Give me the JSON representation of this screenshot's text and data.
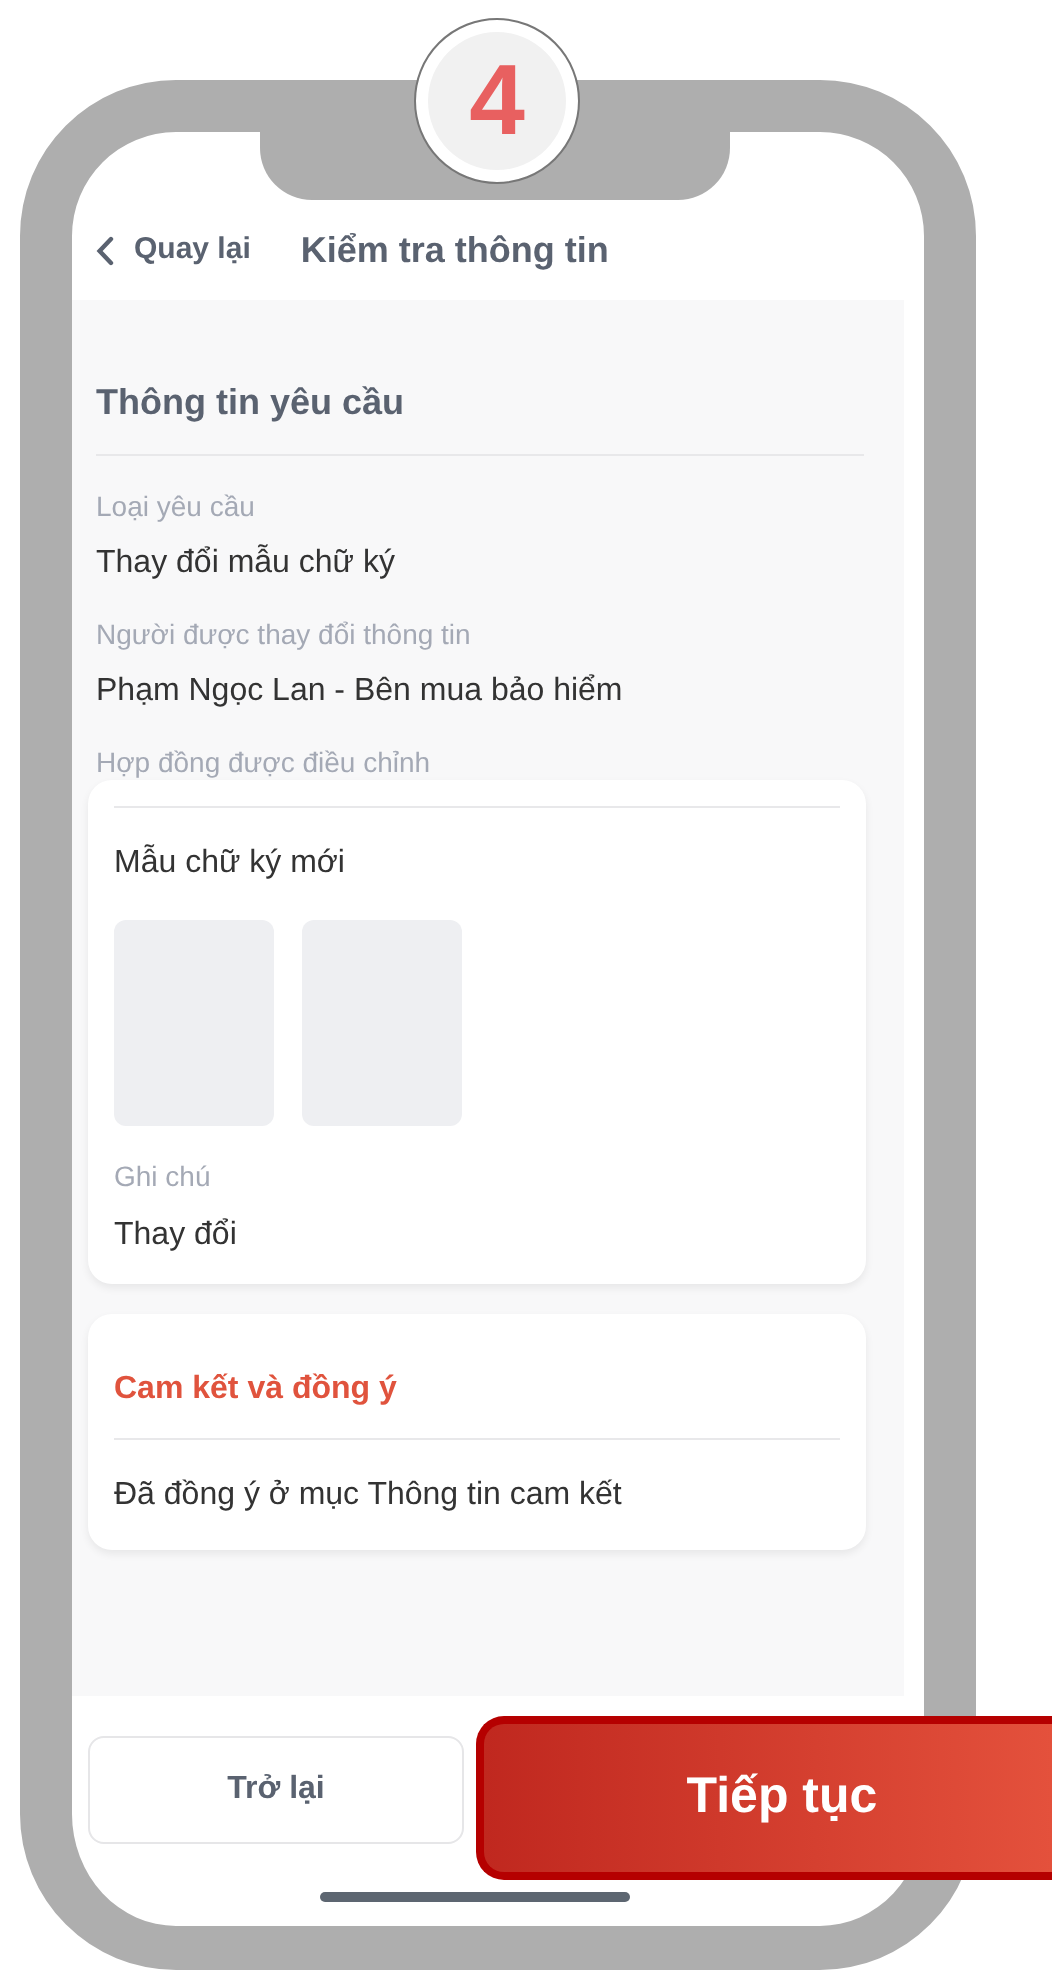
{
  "step_badge": "4",
  "header": {
    "back_label": "Quay lại",
    "title": "Kiểm tra thông tin"
  },
  "request_section": {
    "title": "Thông tin yêu cầu",
    "fields": [
      {
        "label": "Loại yêu cầu",
        "value": "Thay đổi mẫu chữ ký"
      },
      {
        "label": "Người được thay đổi thông tin",
        "value": "Phạm Ngọc Lan - Bên mua bảo hiểm"
      },
      {
        "label": "Hợp đồng được điều chỉnh"
      }
    ]
  },
  "signature_card": {
    "title": "Mẫu chữ ký mới",
    "images": [
      {
        "kind": "placeholder"
      },
      {
        "kind": "placeholder"
      }
    ],
    "note_label": "Ghi chú",
    "note_value": "Thay đổi"
  },
  "commitment_card": {
    "title": "Cam kết và đồng ý",
    "text": "Đã đồng ý ở mục Thông tin cam kết"
  },
  "buttons": [
    {
      "label": "Trở lại",
      "kind": "secondary"
    },
    {
      "label": "Tiếp tục",
      "kind": "primary"
    }
  ]
}
